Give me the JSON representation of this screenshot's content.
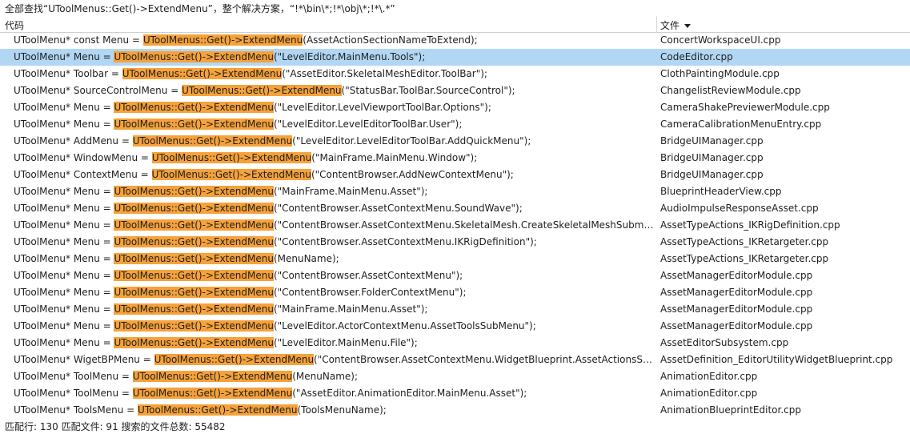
{
  "search_title": "全部查找“UToolMenus::Get()->ExtendMenu”，整个解决方案，“!*\\bin\\*;!*\\obj\\*;!*\\.*”",
  "columns": {
    "code": "代码",
    "file": "文件"
  },
  "highlight_color": "#f6a23a",
  "selected_color": "#b2d7f4",
  "results": [
    {
      "prefix": "UToolMenu* const Menu = ",
      "match": "UToolMenus::Get()->ExtendMenu",
      "suffix": "(AssetActionSectionNameToExtend);",
      "file": "ConcertWorkspaceUI.cpp",
      "selected": false
    },
    {
      "prefix": "UToolMenu* Menu = ",
      "match": "UToolMenus::Get()->ExtendMenu",
      "suffix": "(\"LevelEditor.MainMenu.Tools\");",
      "file": "CodeEditor.cpp",
      "selected": true
    },
    {
      "prefix": "UToolMenu* Toolbar = ",
      "match": "UToolMenus::Get()->ExtendMenu",
      "suffix": "(\"AssetEditor.SkeletalMeshEditor.ToolBar\");",
      "file": "ClothPaintingModule.cpp",
      "selected": false
    },
    {
      "prefix": "UToolMenu* SourceControlMenu = ",
      "match": "UToolMenus::Get()->ExtendMenu",
      "suffix": "(\"StatusBar.ToolBar.SourceControl\");",
      "file": "ChangelistReviewModule.cpp",
      "selected": false
    },
    {
      "prefix": "UToolMenu* Menu = ",
      "match": "UToolMenus::Get()->ExtendMenu",
      "suffix": "(\"LevelEditor.LevelViewportToolBar.Options\");",
      "file": "CameraShakePreviewerModule.cpp",
      "selected": false
    },
    {
      "prefix": "UToolMenu* Menu = ",
      "match": "UToolMenus::Get()->ExtendMenu",
      "suffix": "(\"LevelEditor.LevelEditorToolBar.User\");",
      "file": "CameraCalibrationMenuEntry.cpp",
      "selected": false
    },
    {
      "prefix": "UToolMenu* AddMenu = ",
      "match": "UToolMenus::Get()->ExtendMenu",
      "suffix": "(\"LevelEditor.LevelEditorToolBar.AddQuickMenu\");",
      "file": "BridgeUIManager.cpp",
      "selected": false
    },
    {
      "prefix": "UToolMenu* WindowMenu = ",
      "match": "UToolMenus::Get()->ExtendMenu",
      "suffix": "(\"MainFrame.MainMenu.Window\");",
      "file": "BridgeUIManager.cpp",
      "selected": false
    },
    {
      "prefix": "UToolMenu* ContextMenu = ",
      "match": "UToolMenus::Get()->ExtendMenu",
      "suffix": "(\"ContentBrowser.AddNewContextMenu\");",
      "file": "BridgeUIManager.cpp",
      "selected": false
    },
    {
      "prefix": "UToolMenu* Menu = ",
      "match": "UToolMenus::Get()->ExtendMenu",
      "suffix": "(\"MainFrame.MainMenu.Asset\");",
      "file": "BlueprintHeaderView.cpp",
      "selected": false
    },
    {
      "prefix": "UToolMenu* Menu = ",
      "match": "UToolMenus::Get()->ExtendMenu",
      "suffix": "(\"ContentBrowser.AssetContextMenu.SoundWave\");",
      "file": "AudioImpulseResponseAsset.cpp",
      "selected": false
    },
    {
      "prefix": "UToolMenu* Menu = ",
      "match": "UToolMenus::Get()->ExtendMenu",
      "suffix": "(\"ContentBrowser.AssetContextMenu.SkeletalMesh.CreateSkeletalMeshSubmenu\");",
      "file": "AssetTypeActions_IKRigDefinition.cpp",
      "selected": false
    },
    {
      "prefix": "UToolMenu* Menu = ",
      "match": "UToolMenus::Get()->ExtendMenu",
      "suffix": "(\"ContentBrowser.AssetContextMenu.IKRigDefinition\");",
      "file": "AssetTypeActions_IKRetargeter.cpp",
      "selected": false
    },
    {
      "prefix": "UToolMenu* Menu = ",
      "match": "UToolMenus::Get()->ExtendMenu",
      "suffix": "(MenuName);",
      "file": "AssetTypeActions_IKRetargeter.cpp",
      "selected": false
    },
    {
      "prefix": "UToolMenu* Menu = ",
      "match": "UToolMenus::Get()->ExtendMenu",
      "suffix": "(\"ContentBrowser.AssetContextMenu\");",
      "file": "AssetManagerEditorModule.cpp",
      "selected": false
    },
    {
      "prefix": "UToolMenu* Menu = ",
      "match": "UToolMenus::Get()->ExtendMenu",
      "suffix": "(\"ContentBrowser.FolderContextMenu\");",
      "file": "AssetManagerEditorModule.cpp",
      "selected": false
    },
    {
      "prefix": "UToolMenu* Menu = ",
      "match": "UToolMenus::Get()->ExtendMenu",
      "suffix": "(\"MainFrame.MainMenu.Asset\");",
      "file": "AssetManagerEditorModule.cpp",
      "selected": false
    },
    {
      "prefix": "UToolMenu* Menu = ",
      "match": "UToolMenus::Get()->ExtendMenu",
      "suffix": "(\"LevelEditor.ActorContextMenu.AssetToolsSubMenu\");",
      "file": "AssetManagerEditorModule.cpp",
      "selected": false
    },
    {
      "prefix": "UToolMenu* Menu = ",
      "match": "UToolMenus::Get()->ExtendMenu",
      "suffix": "(\"LevelEditor.MainMenu.File\");",
      "file": "AssetEditorSubsystem.cpp",
      "selected": false
    },
    {
      "prefix": "UToolMenu* WigetBPMenu = ",
      "match": "UToolMenus::Get()->ExtendMenu",
      "suffix": "(\"ContentBrowser.AssetContextMenu.WidgetBlueprint.AssetActionsSubM...",
      "file": "AssetDefinition_EditorUtilityWidgetBlueprint.cpp",
      "selected": false
    },
    {
      "prefix": "UToolMenu* ToolMenu = ",
      "match": "UToolMenus::Get()->ExtendMenu",
      "suffix": "(MenuName);",
      "file": "AnimationEditor.cpp",
      "selected": false
    },
    {
      "prefix": "UToolMenu* ToolMenu = ",
      "match": "UToolMenus::Get()->ExtendMenu",
      "suffix": "(\"AssetEditor.AnimationEditor.MainMenu.Asset\");",
      "file": "AnimationEditor.cpp",
      "selected": false
    },
    {
      "prefix": "UToolMenu* ToolsMenu = ",
      "match": "UToolMenus::Get()->ExtendMenu",
      "suffix": "(ToolsMenuName);",
      "file": "AnimationBlueprintEditor.cpp",
      "selected": false
    }
  ],
  "status": "匹配行: 130 匹配文件: 91 搜索的文件总数: 55482"
}
